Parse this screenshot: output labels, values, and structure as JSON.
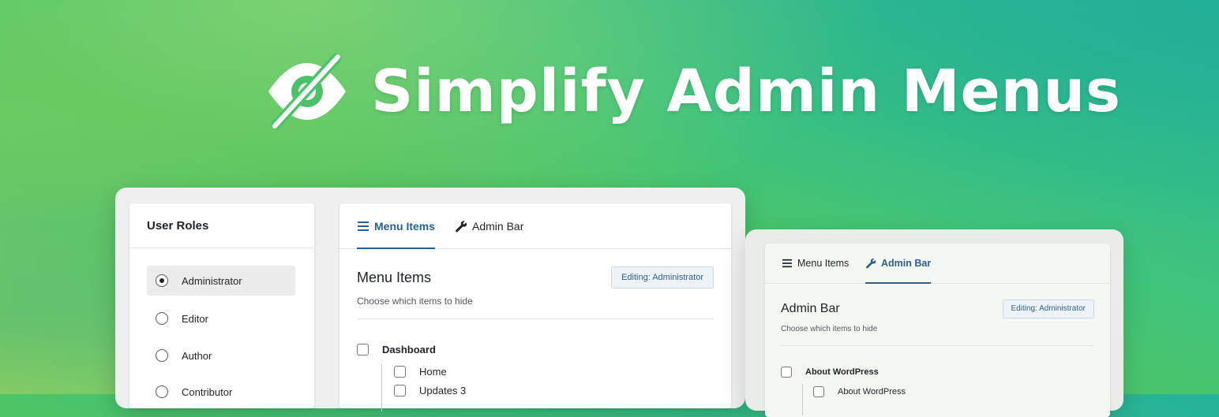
{
  "hero": {
    "title": "Simplify Admin Menus",
    "icon": "eye-slash-icon"
  },
  "roles": {
    "heading": "User Roles",
    "items": [
      {
        "label": "Administrator",
        "selected": true
      },
      {
        "label": "Editor",
        "selected": false
      },
      {
        "label": "Author",
        "selected": false
      },
      {
        "label": "Contributor",
        "selected": false
      }
    ]
  },
  "main_panel": {
    "tabs": [
      {
        "label": "Menu Items",
        "icon": "menu-icon",
        "active": true
      },
      {
        "label": "Admin Bar",
        "icon": "wrench-icon",
        "active": false
      }
    ],
    "title": "Menu Items",
    "subtitle": "Choose which items to hide",
    "badge": "Editing: Administrator",
    "items": [
      {
        "label": "Dashboard",
        "children": [
          "Home",
          "Updates 3"
        ]
      }
    ]
  },
  "admin_bar_panel": {
    "tabs": [
      {
        "label": "Menu Items",
        "icon": "menu-icon",
        "active": false
      },
      {
        "label": "Admin Bar",
        "icon": "wrench-icon",
        "active": true
      }
    ],
    "title": "Admin Bar",
    "subtitle": "Choose which items to hide",
    "badge": "Editing: Administrator",
    "items": [
      {
        "label": "About WordPress",
        "children": [
          "About WordPress"
        ]
      }
    ]
  },
  "colors": {
    "accent": "#2d5f8e",
    "text": "#1d2327",
    "muted": "#50575e"
  }
}
